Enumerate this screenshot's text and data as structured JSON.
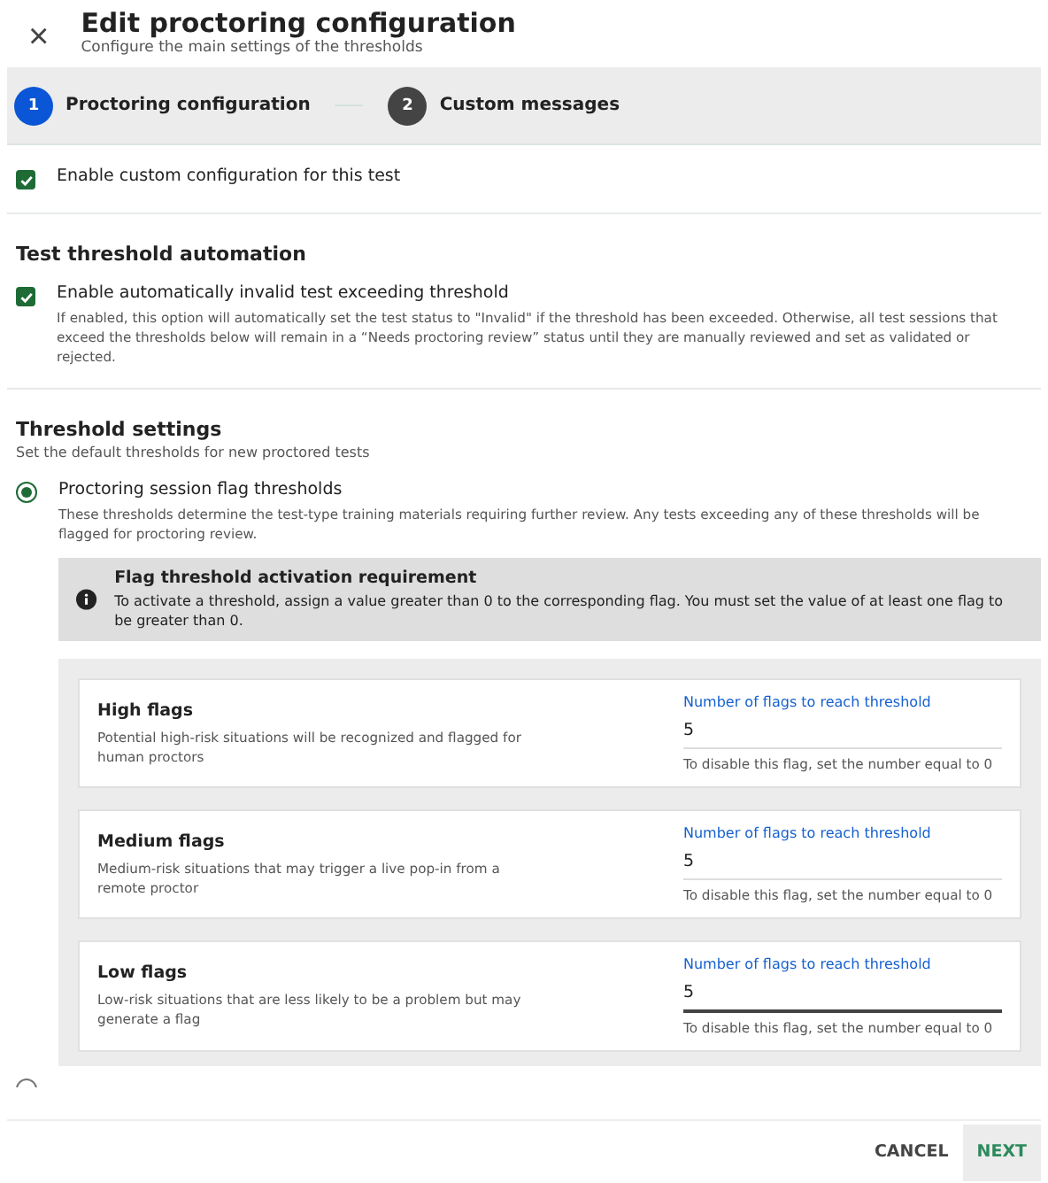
{
  "header": {
    "close": "×",
    "title": "Edit proctoring configuration",
    "subtitle": "Configure the main settings of the thresholds"
  },
  "steps": [
    {
      "number": "1",
      "label": "Proctoring configuration",
      "selected": true
    },
    {
      "number": "2",
      "label": "Custom messages",
      "selected": false
    }
  ],
  "custom_config": {
    "label": "Enable custom configuration for this test",
    "checked": true
  },
  "automation": {
    "heading": "Test threshold automation",
    "label": "Enable automatically invalid test exceeding threshold",
    "checked": true,
    "description": "If enabled, this option will automatically set the test status to \"Invalid\" if the threshold has been exceeded. Otherwise, all test sessions that exceed the thresholds below will remain in a “Needs proctoring review” status until they are manually reviewed and set as validated or rejected."
  },
  "threshold_settings": {
    "heading": "Threshold settings",
    "subtitle": "Set the default thresholds for new proctored tests",
    "option": {
      "label": "Proctoring session flag thresholds",
      "selected": true,
      "description": "These thresholds determine the test-type training materials requiring further review. Any tests exceeding any of these thresholds will be flagged for proctoring review."
    },
    "notice": {
      "title": "Flag threshold activation requirement",
      "text": "To activate a threshold, assign a value greater than 0 to the corresponding flag. You must set the value of at least one flag to be greater than 0."
    },
    "flags": [
      {
        "name": "High flags",
        "description": "Potential high-risk situations will be recognized and flagged for human proctors",
        "field_label": "Number of flags to reach threshold",
        "value": "5",
        "hint": "To disable this flag, set the number equal to 0",
        "focused": false
      },
      {
        "name": "Medium flags",
        "description": "Medium-risk situations that may trigger a live pop-in from a remote proctor",
        "field_label": "Number of flags to reach threshold",
        "value": "5",
        "hint": "To disable this flag, set the number equal to 0",
        "focused": false
      },
      {
        "name": "Low flags",
        "description": "Low-risk situations that are less likely to be a problem but may generate a flag",
        "field_label": "Number of flags to reach threshold",
        "value": "5",
        "hint": "To disable this flag, set the number equal to 0",
        "focused": true
      }
    ],
    "second_option": {
      "selected": false
    }
  },
  "footer": {
    "buttons": [
      {
        "label": "CANCEL",
        "kind": "text"
      },
      {
        "label": "NEXT",
        "kind": "primary"
      }
    ]
  }
}
